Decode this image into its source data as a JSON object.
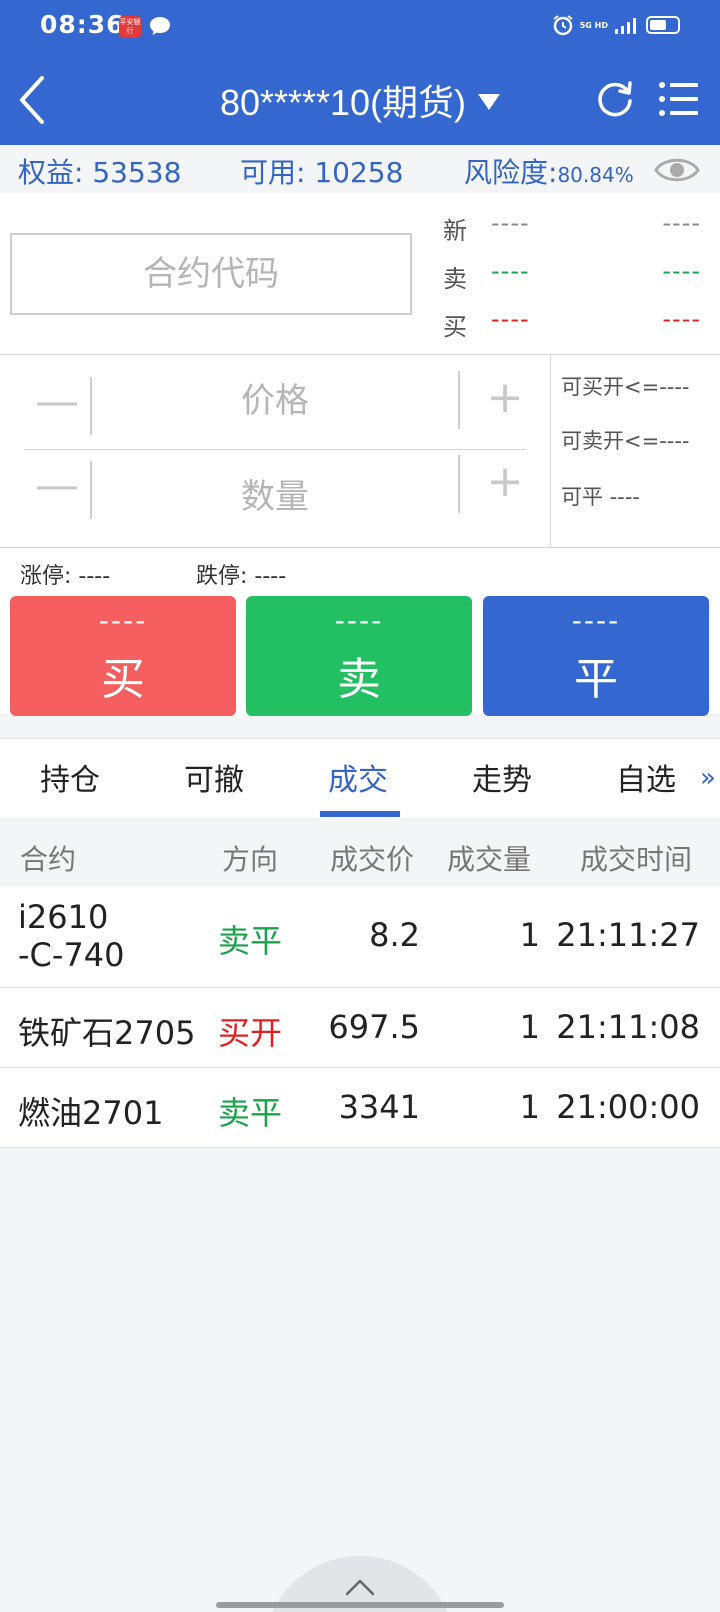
{
  "status_bar": {
    "time": "08:36",
    "app_icon_text": "平安银行",
    "network": "5G HD"
  },
  "header": {
    "account_title": "80*****10(期货)"
  },
  "account": {
    "equity_label": "权益:",
    "equity_value": "53538",
    "available_label": "可用:",
    "available_value": "10258",
    "risk_label": "风险度:",
    "risk_value": "80.84%"
  },
  "quote": {
    "code_placeholder": "合约代码",
    "rows": [
      {
        "label": "新",
        "v1": "----",
        "v2": "----",
        "color": "#888888"
      },
      {
        "label": "卖",
        "v1": "----",
        "v2": "----",
        "color": "#1aa34a"
      },
      {
        "label": "买",
        "v1": "----",
        "v2": "----",
        "color": "#e02020"
      }
    ]
  },
  "order": {
    "minus_symbol": "—",
    "plus_symbol": "+",
    "price_placeholder": "价格",
    "quantity_placeholder": "数量",
    "can_buy_open": "可买开<=----",
    "can_sell_open": "可卖开<=----",
    "can_close": "可平  ----"
  },
  "limits": {
    "limit_up": "涨停: ----",
    "limit_down": "跌停: ----"
  },
  "actions": {
    "buy": {
      "price": "----",
      "label": "买"
    },
    "sell": {
      "price": "----",
      "label": "卖"
    },
    "close": {
      "price": "----",
      "label": "平"
    }
  },
  "tabs": [
    {
      "label": "持仓",
      "active": false
    },
    {
      "label": "可撤",
      "active": false
    },
    {
      "label": "成交",
      "active": true
    },
    {
      "label": "走势",
      "active": false
    },
    {
      "label": "自选",
      "active": false
    }
  ],
  "more_symbol": "»",
  "trades": {
    "headers": [
      "合约",
      "方向",
      "成交价",
      "成交量",
      "成交时间"
    ],
    "rows": [
      {
        "contract": "i2610\n-C-740",
        "direction": "卖平",
        "direction_color": "#1aa34a",
        "price": "8.2",
        "volume": "1",
        "time": "21:11:27"
      },
      {
        "contract": "铁矿石2705",
        "direction": "买开",
        "direction_color": "#e02020",
        "price": "697.5",
        "volume": "1",
        "time": "21:11:08"
      },
      {
        "contract": "燃油2701",
        "direction": "卖平",
        "direction_color": "#1aa34a",
        "price": "3341",
        "volume": "1",
        "time": "21:00:00"
      }
    ]
  }
}
